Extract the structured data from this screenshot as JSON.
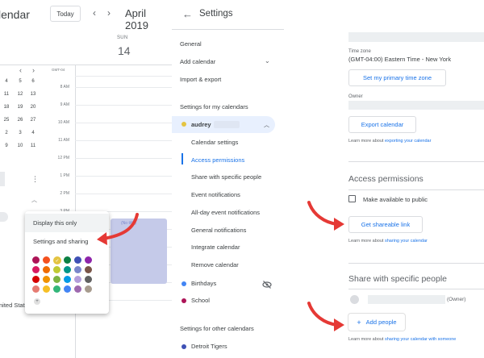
{
  "calendar": {
    "title": "lendar",
    "today_label": "Today",
    "month_label": "April 2019",
    "day_name": "SUN",
    "day_number": "14",
    "tz_label": "GMT-04",
    "hours": [
      "8 AM",
      "9 AM",
      "10 AM",
      "11 AM",
      "12 PM",
      "1 PM",
      "2 PM",
      "3 PM",
      "4 PM",
      "5 PM",
      "6 PM",
      "7 PM",
      "8 PM"
    ],
    "mini_rows": [
      [
        "4",
        "5",
        "6"
      ],
      [
        "11",
        "12",
        "13"
      ],
      [
        "18",
        "19",
        "20"
      ],
      [
        "25",
        "26",
        "27"
      ],
      [
        "2",
        "3",
        "4"
      ],
      [
        "9",
        "10",
        "11"
      ]
    ],
    "event_text": "(No title)",
    "state_text": "nited State",
    "popup": {
      "display_only": "Display this only",
      "settings_sharing": "Settings and sharing",
      "swatches": [
        [
          "#ad1457",
          "#f4511e",
          "#e4c441",
          "#0b8043",
          "#3f51b5",
          "#8e24aa"
        ],
        [
          "#d81b60",
          "#ef6c00",
          "#c0ca33",
          "#009688",
          "#7986cb",
          "#795548"
        ],
        [
          "#d50000",
          "#f09300",
          "#7cb342",
          "#039be5",
          "#b39ddb",
          "#616161"
        ],
        [
          "#e67c73",
          "#f6bf26",
          "#33b679",
          "#4285f4",
          "#9e69af",
          "#a79b8e"
        ]
      ],
      "selected_swatch": "#e4c441"
    }
  },
  "sidebar": {
    "back_icon": "arrow-left-icon",
    "title": "Settings",
    "general": "General",
    "add_calendar": "Add calendar",
    "import_export": "Import & export",
    "my_calendars_heading": "Settings for my calendars",
    "audrey": {
      "name": "audrey",
      "color": "#e4c441"
    },
    "sub_items": [
      "Calendar settings",
      "Access permissions",
      "Share with specific people",
      "Event notifications",
      "All-day event notifications",
      "General notifications",
      "Integrate calendar",
      "Remove calendar"
    ],
    "birthdays": {
      "label": "Birthdays",
      "color": "#4285f4"
    },
    "school": {
      "label": "School",
      "color": "#ad1457"
    },
    "other_calendars_heading": "Settings for other calendars",
    "detroit": {
      "label": "Detroit Tigers",
      "color": "#3f51b5"
    }
  },
  "content": {
    "time_zone_label": "Time zone",
    "time_zone_value": "(GMT-04:00) Eastern Time - New York",
    "set_tz_button": "Set my primary time zone",
    "owner_label": "Owner",
    "export_button": "Export calendar",
    "export_link_prefix": "Learn more about ",
    "export_link": "exporting your calendar",
    "access_heading": "Access permissions",
    "make_public": "Make available to public",
    "shareable_button": "Get shareable link",
    "share_link_prefix": "Learn more about ",
    "share_link": "sharing your calendar",
    "share_heading": "Share with specific people",
    "owner_tag": "(Owner)",
    "add_people": "Add people",
    "add_link_prefix": "Learn more about ",
    "add_link": "sharing your calendar with someone"
  },
  "colors": {
    "accent": "#1a73e8",
    "arrow": "#e53935"
  }
}
